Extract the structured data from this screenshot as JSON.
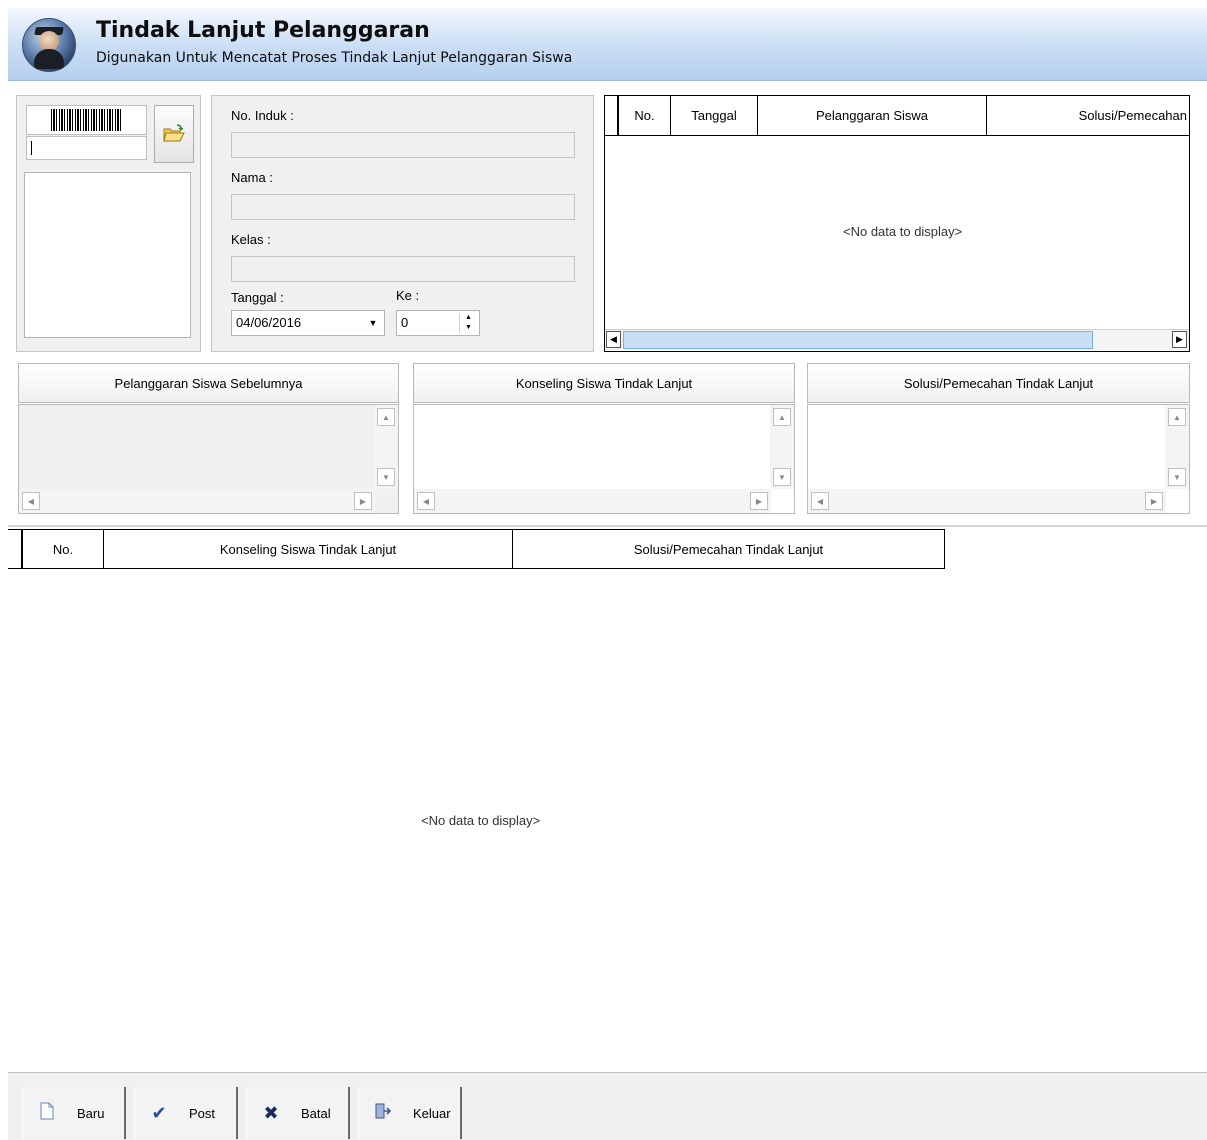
{
  "header": {
    "title": "Tindak Lanjut Pelanggaran",
    "subtitle": "Digunakan Untuk Mencatat Proses Tindak Lanjut Pelanggaran Siswa"
  },
  "student": {
    "barcode_value": "",
    "no_induk_label": "No. Induk :",
    "no_induk_value": "",
    "nama_label": "Nama :",
    "nama_value": "",
    "kelas_label": "Kelas :",
    "kelas_value": "",
    "tanggal_label": "Tanggal :",
    "tanggal_value": "04/06/2016",
    "ke_label": "Ke :",
    "ke_value": "0"
  },
  "violations_grid": {
    "columns": [
      "No.",
      "Tanggal",
      "Pelanggaran Siswa",
      "Solusi/Pemecahan"
    ],
    "empty_text": "<No data to display>"
  },
  "memos": {
    "prev_violation": "Pelanggaran Siswa Sebelumnya",
    "counseling": "Konseling Siswa Tindak Lanjut",
    "solution": "Solusi/Pemecahan Tindak Lanjut"
  },
  "followup_grid": {
    "columns": [
      "No.",
      "Konseling Siswa Tindak Lanjut",
      "Solusi/Pemecahan Tindak Lanjut"
    ],
    "empty_text": "<No data to display>"
  },
  "toolbar": {
    "baru": "Baru",
    "post": "Post",
    "batal": "Batal",
    "keluar": "Keluar"
  },
  "icons": {
    "logo": "student-logo-icon",
    "folder": "open-folder-icon",
    "baru": "new-document-icon",
    "post": "checkmark-icon",
    "batal": "x-cancel-icon",
    "keluar": "exit-door-icon"
  },
  "colors": {
    "header_gradient_top": "#f3f7fd",
    "header_gradient_bottom": "#b6cfee",
    "scroll_thumb": "#c7e0f8",
    "check_blue": "#1f4ea3",
    "cancel_navy": "#1b2a5a"
  }
}
